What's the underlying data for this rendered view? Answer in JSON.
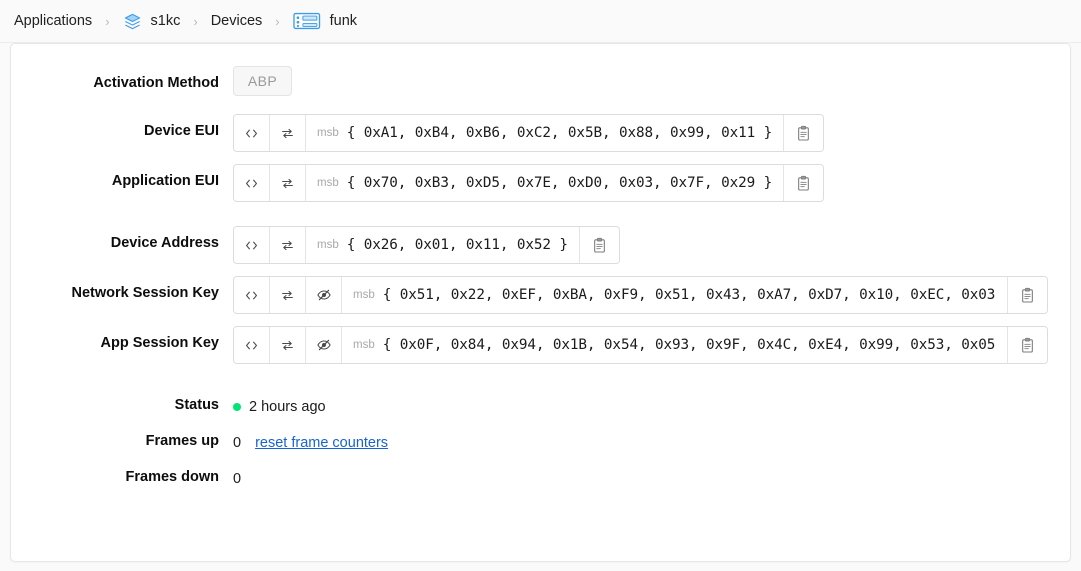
{
  "breadcrumb": {
    "items": [
      {
        "label": "Applications",
        "icon": null
      },
      {
        "label": "s1kc",
        "icon": "layers-stack-icon"
      },
      {
        "label": "Devices",
        "icon": null
      },
      {
        "label": "funk",
        "icon": "device-board-icon"
      }
    ],
    "separator": "›"
  },
  "colors": {
    "page_bg": "#fafafa",
    "card_bg": "#ffffff",
    "link": "#1763d6",
    "status_green": "#00e676",
    "icon_blue": "#4aa3ef",
    "muted": "#a8a8a8"
  },
  "form": {
    "activation": {
      "label": "Activation Method",
      "value": "ABP"
    },
    "device_eui": {
      "label": "Device EUI",
      "msb": "msb",
      "value": "{ 0xA1, 0xB4, 0xB6, 0xC2, 0x5B, 0x88, 0x99, 0x11 }",
      "code_icon": "code-brackets-icon",
      "swap_icon": "swap-arrows-icon",
      "copy_icon": "clipboard-copy-icon"
    },
    "application_eui": {
      "label": "Application EUI",
      "msb": "msb",
      "value": "{ 0x70, 0xB3, 0xD5, 0x7E, 0xD0, 0x03, 0x7F, 0x29 }",
      "code_icon": "code-brackets-icon",
      "swap_icon": "swap-arrows-icon",
      "copy_icon": "clipboard-copy-icon"
    },
    "device_address": {
      "label": "Device Address",
      "msb": "msb",
      "value": "{ 0x26, 0x01, 0x11, 0x52 }",
      "code_icon": "code-brackets-icon",
      "swap_icon": "swap-arrows-icon",
      "copy_icon": "clipboard-copy-icon"
    },
    "network_session_key": {
      "label": "Network Session Key",
      "msb": "msb",
      "value": "{ 0x51, 0x22, 0xEF, 0xBA, 0xF9, 0x51, 0x43, 0xA7, 0xD7, 0x10, 0xEC, 0x03,",
      "code_icon": "code-brackets-icon",
      "swap_icon": "swap-arrows-icon",
      "hide_icon": "eye-slash-icon",
      "copy_icon": "clipboard-copy-icon"
    },
    "app_session_key": {
      "label": "App Session Key",
      "msb": "msb",
      "value": "{ 0x0F, 0x84, 0x94, 0x1B, 0x54, 0x93, 0x9F, 0x4C, 0xE4, 0x99, 0x53, 0x05,",
      "code_icon": "code-brackets-icon",
      "swap_icon": "swap-arrows-icon",
      "hide_icon": "eye-slash-icon",
      "copy_icon": "clipboard-copy-icon"
    },
    "status": {
      "label": "Status",
      "value": "2 hours ago",
      "indicator": "online-dot"
    },
    "frames_up": {
      "label": "Frames up",
      "value": "0",
      "action_label": "reset frame counters"
    },
    "frames_down": {
      "label": "Frames down",
      "value": "0"
    }
  }
}
